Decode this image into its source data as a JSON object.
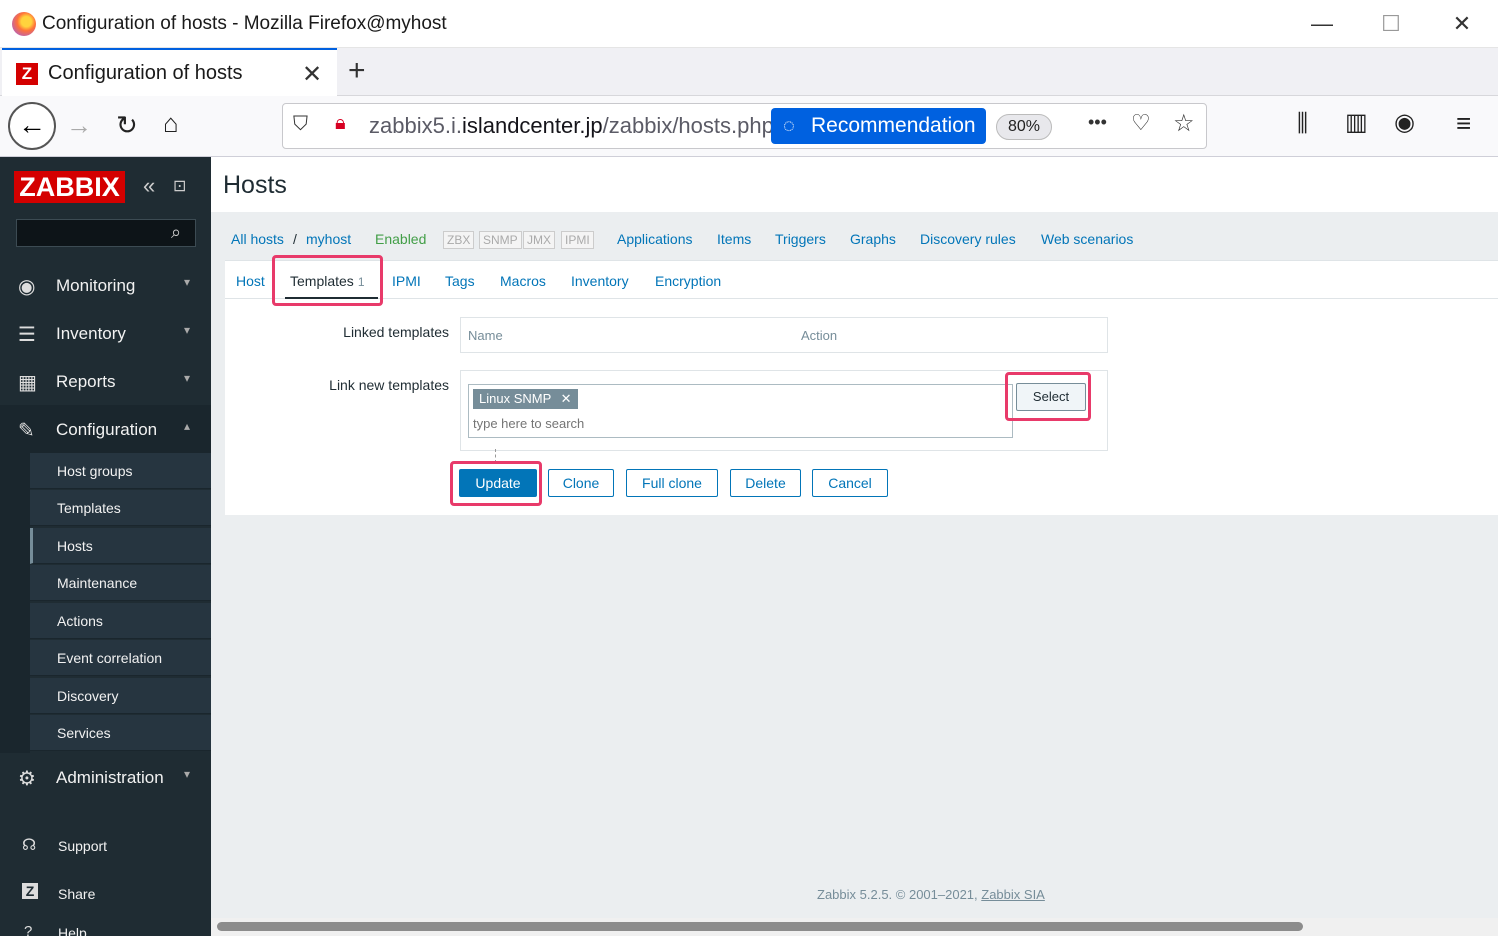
{
  "window": {
    "title": "Configuration of hosts - Mozilla Firefox@myhost",
    "minimize": "—",
    "maximize": "☐",
    "close": "✕"
  },
  "tab": {
    "label": "Configuration of hosts",
    "close": "✕",
    "new_tab": "+"
  },
  "nav": {
    "url_prefix": "zabbix5.i.",
    "url_domain": "islandcenter.jp",
    "url_path": "/zabbix/hosts.php",
    "recommendation_label": "Recommendation",
    "zoom": "80%",
    "more": "•••"
  },
  "sidebar": {
    "logo": "ZABBIX",
    "collapse_icon": "«",
    "kiosk_icon": "⊡",
    "menu": [
      {
        "label": "Monitoring",
        "icon": "eye-icon"
      },
      {
        "label": "Inventory",
        "icon": "list-icon"
      },
      {
        "label": "Reports",
        "icon": "bar-chart-icon"
      },
      {
        "label": "Configuration",
        "icon": "wrench-icon"
      }
    ],
    "config_items": [
      "Host groups",
      "Templates",
      "Hosts",
      "Maintenance",
      "Actions",
      "Event correlation",
      "Discovery",
      "Services"
    ],
    "administration": "Administration",
    "support": "Support",
    "share": "Share",
    "help": "Help"
  },
  "page": {
    "title": "Hosts",
    "breadcrumbs": {
      "all_hosts": "All hosts",
      "sep": "/",
      "host": "myhost",
      "status": "Enabled",
      "availability": [
        "ZBX",
        "SNMP",
        "JMX",
        "IPMI"
      ],
      "links": [
        "Applications",
        "Items",
        "Triggers",
        "Graphs",
        "Discovery rules",
        "Web scenarios"
      ]
    },
    "tabs": {
      "host": "Host",
      "templates": "Templates",
      "templates_count": "1",
      "ipmi": "IPMI",
      "tags": "Tags",
      "macros": "Macros",
      "inventory": "Inventory",
      "encryption": "Encryption"
    },
    "form": {
      "linked_label": "Linked templates",
      "col_name": "Name",
      "col_action": "Action",
      "link_new_label": "Link new templates",
      "chip": "Linux SNMP",
      "chip_remove": "✕",
      "search_placeholder": "type here to search",
      "select_button": "Select"
    },
    "buttons": {
      "update": "Update",
      "clone": "Clone",
      "full_clone": "Full clone",
      "delete": "Delete",
      "cancel": "Cancel"
    },
    "footer": {
      "text": "Zabbix 5.2.5. © 2001–2021, ",
      "link": "Zabbix SIA"
    }
  },
  "colors": {
    "accent": "#0275b8",
    "highlight": "#e83a6a",
    "sidebar": "#1f2c33",
    "enabled": "#429e47"
  }
}
